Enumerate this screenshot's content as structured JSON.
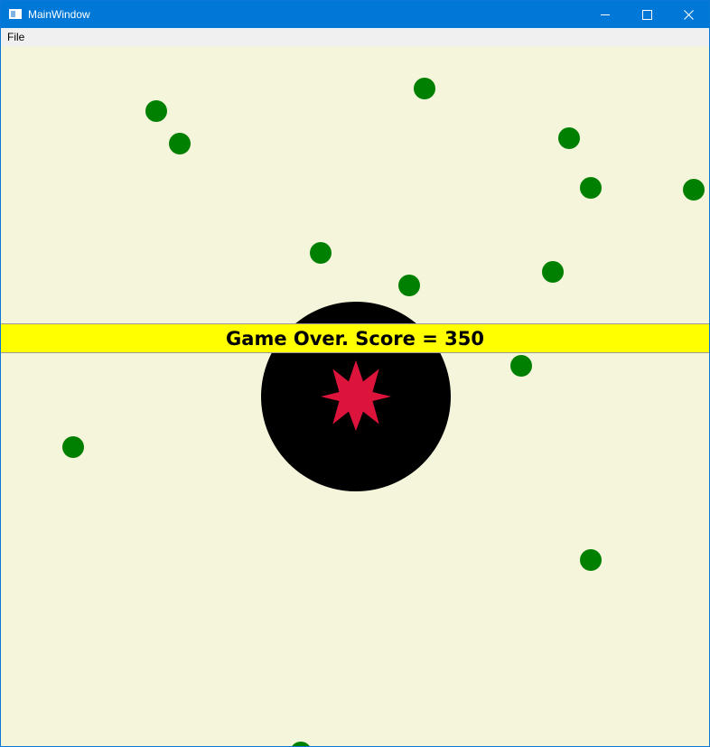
{
  "window": {
    "title": "MainWindow",
    "icon": "window-app-icon",
    "controls": [
      "minimize-icon",
      "maximize-icon",
      "close-icon"
    ]
  },
  "menu": {
    "items": [
      {
        "label": "File"
      }
    ]
  },
  "game": {
    "message": "Game Over. Score = 350",
    "colors": {
      "background": "#f5f5dc",
      "enemy": "#008000",
      "player": "#000000",
      "explosion": "#dc143c",
      "banner": "#ffff00"
    },
    "player": {
      "icon": "explosion-star-icon"
    },
    "enemies_count": 14
  }
}
